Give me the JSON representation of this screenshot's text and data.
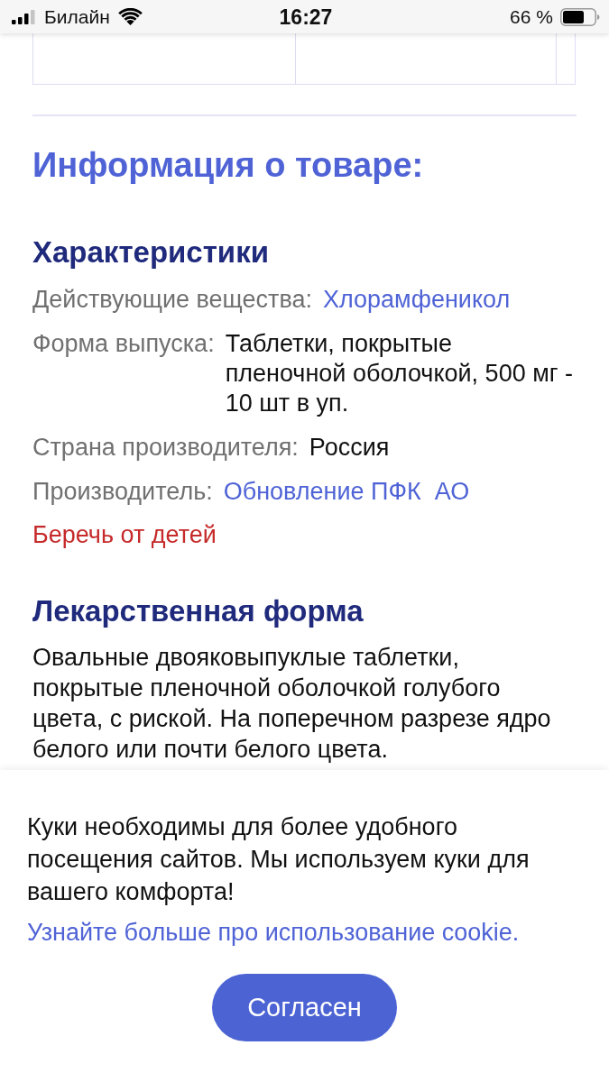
{
  "status_bar": {
    "carrier": "Билайн",
    "time": "16:27",
    "battery": "66 %"
  },
  "heading": "Информация о товаре:",
  "characteristics": {
    "title": "Характеристики",
    "rows": [
      {
        "label": "Действующие вещества:",
        "value": "Хлорамфеникол",
        "kind": "link"
      },
      {
        "label": "Форма выпуска:",
        "value": "Таблетки, покрытые пленочной оболочкой, 500 мг - 10 шт в уп.",
        "kind": "text"
      },
      {
        "label": "Страна производителя:",
        "value": "Россия",
        "kind": "text"
      },
      {
        "label": "Производитель:",
        "value": "Обновление ПФК  АО",
        "kind": "link"
      }
    ],
    "warning": "Беречь от детей"
  },
  "dosage_form": {
    "title": "Лекарственная форма",
    "text": "Овальные двояковыпуклые таблетки, покрытые пленочной оболочкой голубого цвета, с риской. На поперечном разрезе ядро белого или почти белого цвета."
  },
  "cookie_banner": {
    "text": "Куки необходимы для более удобного посещения сайтов. Мы используем куки для вашего комфорта!",
    "link": "Узнайте больше про использование cookie.",
    "button": "Согласен"
  }
}
